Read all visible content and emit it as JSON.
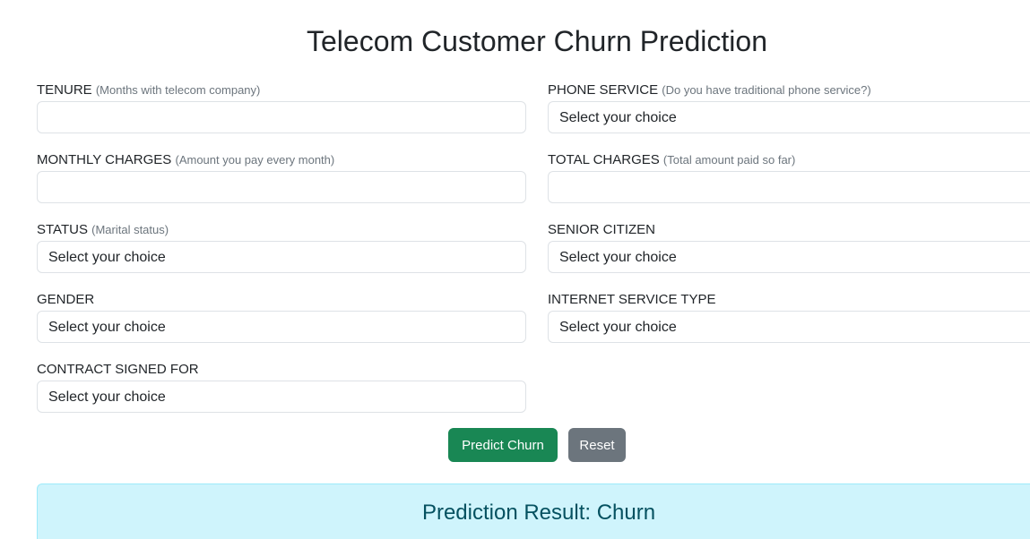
{
  "page": {
    "title": "Telecom Customer Churn Prediction"
  },
  "form": {
    "tenure": {
      "label": "TENURE",
      "hint": "(Months with telecom company)",
      "value": ""
    },
    "phone_service": {
      "label": "PHONE SERVICE",
      "hint": "(Do you have traditional phone service?)",
      "selected": "Select your choice"
    },
    "monthly_charges": {
      "label": "MONTHLY CHARGES",
      "hint": "(Amount you pay every month)",
      "value": ""
    },
    "total_charges": {
      "label": "TOTAL CHARGES",
      "hint": "(Total amount paid so far)",
      "value": ""
    },
    "status": {
      "label": "STATUS",
      "hint": "(Marital status)",
      "selected": "Select your choice"
    },
    "senior_citizen": {
      "label": "SENIOR CITIZEN",
      "selected": "Select your choice"
    },
    "gender": {
      "label": "GENDER",
      "selected": "Select your choice"
    },
    "internet_service_type": {
      "label": "INTERNET SERVICE TYPE",
      "selected": "Select your choice"
    },
    "contract_signed_for": {
      "label": "CONTRACT SIGNED FOR",
      "selected": "Select your choice"
    }
  },
  "actions": {
    "predict_label": "Predict Churn",
    "reset_label": "Reset"
  },
  "result": {
    "text": "Prediction Result: Churn"
  },
  "colors": {
    "success": "#198754",
    "secondary": "#6c757d",
    "result_bg": "#cff4fc",
    "result_text": "#055160"
  }
}
